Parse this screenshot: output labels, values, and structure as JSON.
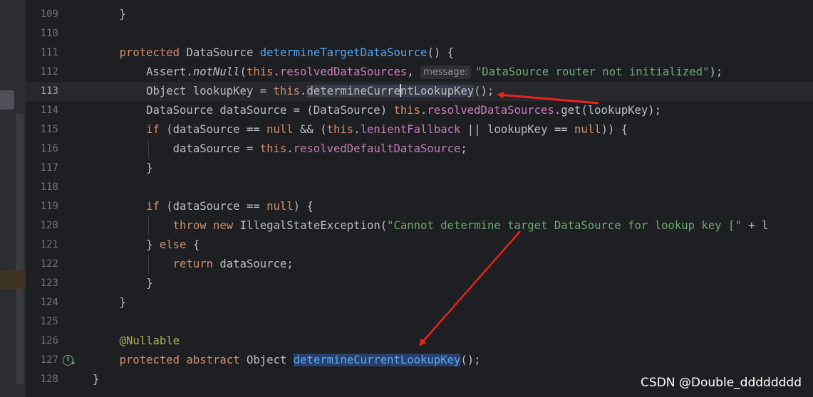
{
  "editor": {
    "lines": [
      {
        "no": "109",
        "code": "    }"
      },
      {
        "no": "110",
        "code": ""
      },
      {
        "no": "111",
        "code": "    protected DataSource determineTargetDataSource() {"
      },
      {
        "no": "112",
        "code": "        Assert.notNull(this.resolvedDataSources, message: \"DataSource router not initialized\");",
        "hint": "message:"
      },
      {
        "no": "113",
        "code": "        Object lookupKey = this.determineCurrentLookupKey();"
      },
      {
        "no": "114",
        "code": "        DataSource dataSource = (DataSource) this.resolvedDataSources.get(lookupKey);"
      },
      {
        "no": "115",
        "code": "        if (dataSource == null && (this.lenientFallback || lookupKey == null)) {"
      },
      {
        "no": "116",
        "code": "            dataSource = this.resolvedDefaultDataSource;"
      },
      {
        "no": "117",
        "code": "        }"
      },
      {
        "no": "118",
        "code": ""
      },
      {
        "no": "119",
        "code": "        if (dataSource == null) {"
      },
      {
        "no": "120",
        "code": "            throw new IllegalStateException(\"Cannot determine target DataSource for lookup key [\" + l"
      },
      {
        "no": "121",
        "code": "        } else {"
      },
      {
        "no": "122",
        "code": "            return dataSource;"
      },
      {
        "no": "123",
        "code": "        }"
      },
      {
        "no": "124",
        "code": "    }"
      },
      {
        "no": "125",
        "code": ""
      },
      {
        "no": "126",
        "code": "    @Nullable"
      },
      {
        "no": "127",
        "code": "    protected abstract Object determineCurrentLookupKey();"
      },
      {
        "no": "128",
        "code": "}"
      }
    ],
    "current_line": "113",
    "override_icon": "implementation-marker-icon"
  },
  "watermark": "CSDN @Double_dddddddd",
  "colors": {
    "background": "#1e1f22",
    "keyword": "#cf8e6d",
    "string": "#6aab73",
    "field": "#c77dbb",
    "method": "#56a8f5",
    "annotation": "#b3ae60",
    "arrow": "#e8231b"
  }
}
